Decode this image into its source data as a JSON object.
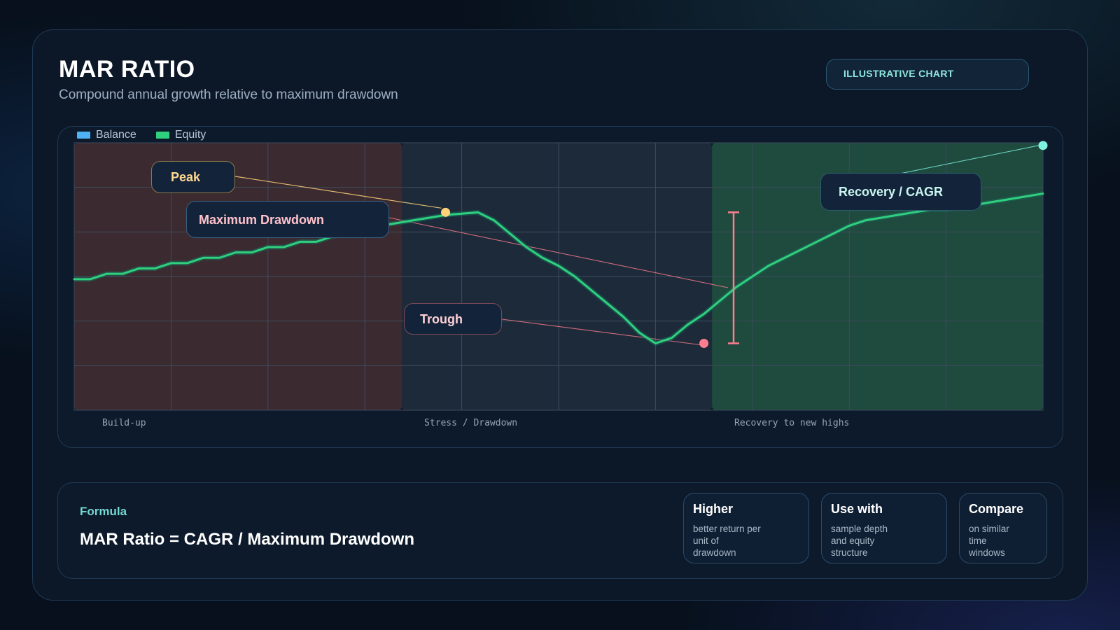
{
  "header": {
    "title": "MAR RATIO",
    "subtitle": "Compound annual growth relative to maximum drawdown",
    "badge": "ILLUSTRATIVE CHART"
  },
  "legend": [
    {
      "label": "Balance",
      "color": "#4db3f5"
    },
    {
      "label": "Equity",
      "color": "#2fd07e"
    }
  ],
  "callouts": {
    "peak": "Peak",
    "max_drawdown": "Maximum Drawdown",
    "trough": "Trough",
    "recovery": "Recovery / CAGR"
  },
  "zones": [
    "Build-up",
    "Stress / Drawdown",
    "Recovery to new highs"
  ],
  "formula": {
    "label": "Formula",
    "text": "MAR Ratio = CAGR / Maximum Drawdown"
  },
  "info_cards": [
    {
      "head": "Higher",
      "body": "better return per unit of drawdown"
    },
    {
      "head": "Use with",
      "body": "sample depth and equity structure"
    },
    {
      "head": "Compare",
      "body": "on similar time windows"
    }
  ],
  "colors": {
    "equity": "#2fd07e",
    "balance": "#4db3f5",
    "peak": "#ffd27a",
    "trough": "#ff7d8e",
    "recovery": "#7cf2df",
    "zone_buildup": "#3b2a30",
    "zone_stress": "#1c2a3a",
    "zone_recovery": "#1f4a3e"
  },
  "chart_data": {
    "type": "line",
    "series": [
      {
        "name": "Equity",
        "x": [
          0,
          1,
          2,
          3,
          4,
          5,
          6,
          7,
          8,
          9,
          10,
          11,
          12,
          13,
          14,
          15,
          16,
          17,
          18,
          19,
          20,
          21,
          22,
          23,
          24,
          25,
          26,
          27,
          28,
          29,
          30,
          31,
          32,
          33,
          34,
          35,
          36,
          37,
          38,
          39,
          40,
          41,
          42,
          43,
          44,
          45,
          46,
          47,
          48,
          49,
          50,
          51,
          52,
          53,
          54,
          55,
          56,
          57,
          58,
          59,
          60
        ],
        "values": [
          49,
          49,
          51,
          51,
          53,
          53,
          55,
          55,
          57,
          57,
          59,
          59,
          61,
          61,
          63,
          63,
          65,
          66,
          68,
          69,
          70,
          71,
          72,
          73,
          73.5,
          74,
          71,
          66,
          61,
          57,
          54,
          50,
          45,
          40,
          35,
          29,
          25,
          27,
          32,
          36,
          41,
          46,
          50,
          54,
          57,
          60,
          63,
          66,
          69,
          71,
          72,
          73,
          74,
          75,
          75,
          76,
          77,
          78,
          79,
          80,
          81
        ],
        "color": "#2fd07e"
      }
    ],
    "peak": {
      "x": 23,
      "y": 74
    },
    "trough": {
      "x": 39,
      "y": 25
    },
    "end": {
      "x": 60,
      "y": 99
    },
    "xlim": [
      0,
      60
    ],
    "ylim": [
      0,
      100
    ],
    "zones": [
      {
        "label": "Build-up",
        "x0": 0,
        "x1": 20.3
      },
      {
        "label": "Stress / Drawdown",
        "x0": 20.3,
        "x1": 39.5
      },
      {
        "label": "Recovery to new highs",
        "x0": 39.5,
        "x1": 60
      }
    ],
    "grid": true,
    "legend_position": "top-left"
  }
}
